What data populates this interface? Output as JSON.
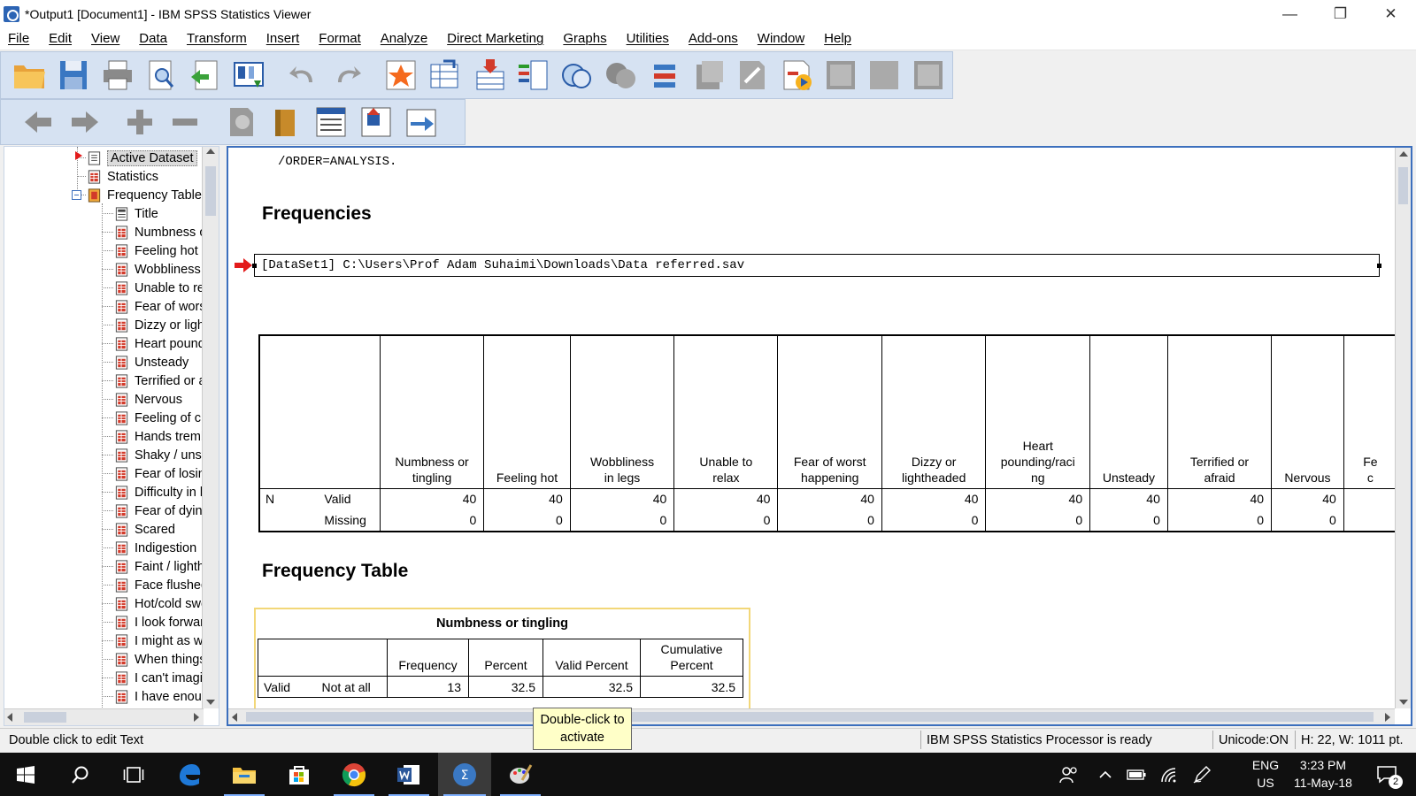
{
  "window": {
    "title": "*Output1 [Document1] - IBM SPSS Statistics Viewer"
  },
  "menu": [
    "File",
    "Edit",
    "View",
    "Data",
    "Transform",
    "Insert",
    "Format",
    "Analyze",
    "Direct Marketing",
    "Graphs",
    "Utilities",
    "Add-ons",
    "Window",
    "Help"
  ],
  "toolbar1": [
    "open-icon",
    "save-icon",
    "print-icon",
    "print-preview-icon",
    "export-icon",
    "recall-dialog-icon",
    "undo-icon",
    "redo-icon",
    "goto-data-icon",
    "goto-case-icon",
    "variables-icon",
    "chart-builder-icon",
    "select-cases-icon",
    "weight-cases-icon",
    "split-file-icon",
    "value-labels-icon",
    "designate-window-icon",
    "show-results-icon",
    "insert-output-icon",
    "run-script-icon",
    "full-screen-icon"
  ],
  "toolbar2": [
    "back-icon",
    "forward-icon",
    "expand-icon",
    "collapse-icon",
    "show-icon",
    "hide-icon",
    "insert-heading-icon",
    "insert-title-icon",
    "insert-text-icon"
  ],
  "outline": {
    "items": [
      {
        "label": "Active Dataset",
        "level": 1,
        "selected": true,
        "icon": "log-icon"
      },
      {
        "label": "Statistics",
        "level": 1,
        "icon": "table-icon"
      },
      {
        "label": "Frequency Table",
        "level": 1,
        "icon": "book-icon"
      },
      {
        "label": "Title",
        "level": 2,
        "icon": "title-icon"
      },
      {
        "label": "Numbness or tingling",
        "level": 2,
        "icon": "table-icon"
      },
      {
        "label": "Feeling hot",
        "level": 2,
        "icon": "table-icon"
      },
      {
        "label": "Wobbliness in legs",
        "level": 2,
        "icon": "table-icon"
      },
      {
        "label": "Unable to relax",
        "level": 2,
        "icon": "table-icon"
      },
      {
        "label": "Fear of worst happening",
        "level": 2,
        "icon": "table-icon"
      },
      {
        "label": "Dizzy or lightheaded",
        "level": 2,
        "icon": "table-icon"
      },
      {
        "label": "Heart pounding/racing",
        "level": 2,
        "icon": "table-icon"
      },
      {
        "label": "Unsteady",
        "level": 2,
        "icon": "table-icon"
      },
      {
        "label": "Terrified or afraid",
        "level": 2,
        "icon": "table-icon"
      },
      {
        "label": "Nervous",
        "level": 2,
        "icon": "table-icon"
      },
      {
        "label": "Feeling of choking",
        "level": 2,
        "icon": "table-icon"
      },
      {
        "label": "Hands trembling",
        "level": 2,
        "icon": "table-icon"
      },
      {
        "label": "Shaky / unsteady",
        "level": 2,
        "icon": "table-icon"
      },
      {
        "label": "Fear of losing control",
        "level": 2,
        "icon": "table-icon"
      },
      {
        "label": "Difficulty in breathing",
        "level": 2,
        "icon": "table-icon"
      },
      {
        "label": "Fear of dying",
        "level": 2,
        "icon": "table-icon"
      },
      {
        "label": "Scared",
        "level": 2,
        "icon": "table-icon"
      },
      {
        "label": "Indigestion",
        "level": 2,
        "icon": "table-icon"
      },
      {
        "label": "Faint / lightheaded",
        "level": 2,
        "icon": "table-icon"
      },
      {
        "label": "Face flushed",
        "level": 2,
        "icon": "table-icon"
      },
      {
        "label": "Hot/cold sweats",
        "level": 2,
        "icon": "table-icon"
      },
      {
        "label": "I look forward",
        "level": 2,
        "icon": "table-icon"
      },
      {
        "label": "I might as well",
        "level": 2,
        "icon": "table-icon"
      },
      {
        "label": "When things",
        "level": 2,
        "icon": "table-icon"
      },
      {
        "label": "I can't imagine",
        "level": 2,
        "icon": "table-icon"
      },
      {
        "label": "I have enough",
        "level": 2,
        "icon": "table-icon"
      }
    ]
  },
  "content": {
    "syntax_line": "/ORDER=ANALYSIS.",
    "frequencies_heading": "Frequencies",
    "dataset_line": "[DataSet1] C:\\Users\\Prof Adam Suhaimi\\Downloads\\Data referred.sav",
    "stats_table": {
      "n_label": "N",
      "row_labels": [
        "Valid",
        "Missing"
      ],
      "columns": [
        {
          "h1": "Numbness or",
          "h2": "tingling",
          "valid": "40",
          "missing": "0",
          "w": 118
        },
        {
          "h1": "",
          "h2": "Feeling hot",
          "valid": "40",
          "missing": "0",
          "w": 98
        },
        {
          "h1": "Wobbliness",
          "h2": "in legs",
          "valid": "40",
          "missing": "0",
          "w": 118
        },
        {
          "h1": "Unable to",
          "h2": "relax",
          "valid": "40",
          "missing": "0",
          "w": 118
        },
        {
          "h1": "Fear of worst",
          "h2": "happening",
          "valid": "40",
          "missing": "0",
          "w": 118
        },
        {
          "h1": "Dizzy or",
          "h2": "lightheaded",
          "valid": "40",
          "missing": "0",
          "w": 118
        },
        {
          "h0": "Heart",
          "h1": "pounding/raci",
          "h2": "ng",
          "valid": "40",
          "missing": "0",
          "w": 118
        },
        {
          "h1": "",
          "h2": "Unsteady",
          "valid": "40",
          "missing": "0",
          "w": 88
        },
        {
          "h1": "Terrified or",
          "h2": "afraid",
          "valid": "40",
          "missing": "0",
          "w": 118
        },
        {
          "h1": "",
          "h2": "Nervous",
          "valid": "40",
          "missing": "0",
          "w": 82
        },
        {
          "h1": "Fe",
          "h2": "c",
          "valid": "",
          "missing": "",
          "w": 60
        }
      ]
    },
    "freq_table_heading": "Frequency Table",
    "freq_table": {
      "title": "Numbness or tingling",
      "headers": [
        "Frequency",
        "Percent",
        "Valid Percent",
        "Cumulative Percent"
      ],
      "rows": [
        {
          "group": "Valid",
          "label": "Not at all",
          "frequency": "13",
          "percent": "32.5",
          "valid_percent": "32.5",
          "cumulative": "32.5"
        }
      ]
    },
    "tooltip": "Double-click to activate"
  },
  "statusbar": {
    "left": "Double click to edit Text",
    "processor": "IBM SPSS Statistics Processor is ready",
    "unicode": "Unicode:ON",
    "size": "H: 22, W: 1011 pt."
  },
  "taskbar": {
    "lang1": "ENG",
    "lang2": "US",
    "time": "3:23 PM",
    "date": "11-May-18",
    "notif_count": "2"
  },
  "colors": {
    "toolbar_bg": "#d6e2f2",
    "content_border": "#3c6fbd",
    "tooltip_bg": "#ffffc8",
    "pivot_highlight": "#f2d778"
  }
}
